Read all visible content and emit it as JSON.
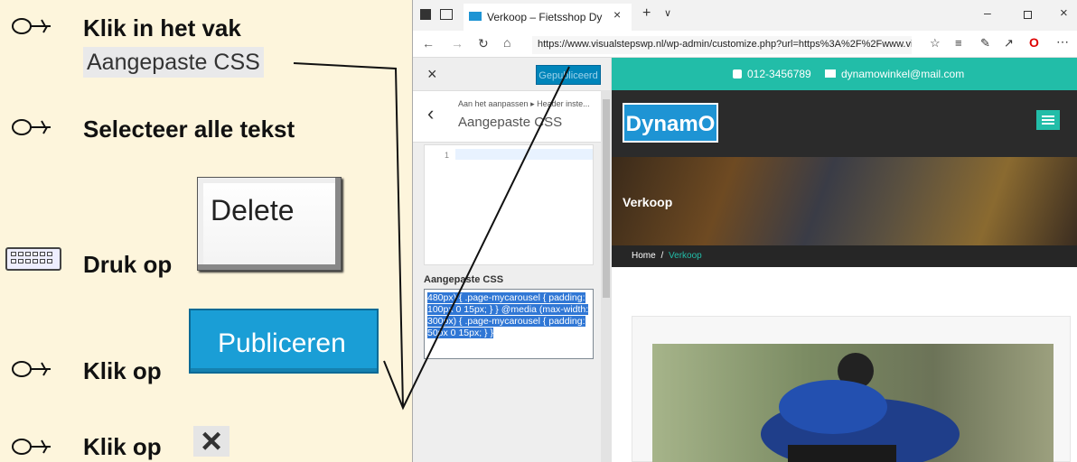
{
  "instructions": {
    "step1": "Klik in het vak",
    "step1_box": "Aangepaste CSS",
    "step2": "Selecteer alle tekst",
    "step3": "Druk op",
    "step3_key": "Delete",
    "step4": "Klik op",
    "step4_button": "Publiceren",
    "step5": "Klik op",
    "step5_icon": "×"
  },
  "browser": {
    "tab_title": "Verkoop – Fietsshop Dy",
    "url": "https://www.visualstepswp.nl/wp-admin/customize.php?url=https%3A%2F%2Fwww.vi"
  },
  "customizer": {
    "close_icon": "×",
    "publish_label": "Gepubliceerd",
    "back_icon": "‹",
    "breadcrumb": "Aan het aanpassen ▸ Header inste...",
    "section_title": "Aangepaste CSS",
    "line_number": "1",
    "field_label": "Aangepaste CSS",
    "css_text": "480px) { .page-mycarousel { padding: 100px 0 15px; } } @media (max-width: 300px) { .page-mycarousel { padding: 50px 0 15px; } }"
  },
  "site": {
    "phone": "012-3456789",
    "email": "dynamowinkel@mail.com",
    "logo": "DynamO",
    "hero_title": "Verkoop",
    "crumb_home": "Home",
    "crumb_sep": "/",
    "crumb_current": "Verkoop"
  },
  "colors": {
    "accent": "#22bda8",
    "logo_bg": "#1e94d4",
    "publish": "#0085ba"
  }
}
